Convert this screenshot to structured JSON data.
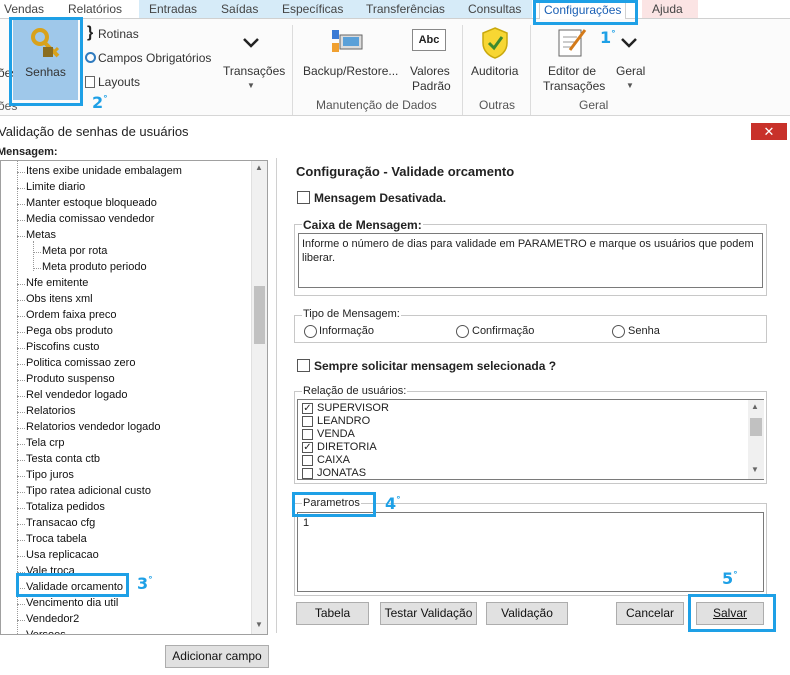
{
  "ribbon_tabs": [
    "Vendas",
    "Relatórios",
    "Entradas",
    "Saídas",
    "Específicas",
    "Transferências",
    "Consultas",
    "Configurações",
    "Ajuda"
  ],
  "ribbon": {
    "partial_left_1": "ões",
    "partial_left_2": "ões",
    "senhas": "Senhas",
    "rotinas": "Rotinas",
    "campos_obrigatorios": "Campos Obrigatórios",
    "layouts": "Layouts",
    "transacoes": "Transações",
    "backup": "Backup/Restore...",
    "valores": "Valores",
    "padrao": "Padrão",
    "manutencao_label": "Manutenção de Dados",
    "auditoria": "Auditoria",
    "outras_label": "Outras",
    "editor": "Editor de",
    "editor2": "Transações",
    "geral": "Geral",
    "geral_group": "Geral"
  },
  "steps": [
    "1",
    "2",
    "3",
    "4",
    "5"
  ],
  "step_mark": "°",
  "window": {
    "title": "Validação de senhas de usuários",
    "close": "✕"
  },
  "tree": {
    "header": "Mensagem:",
    "items": [
      "Itens exibe unidade embalagem",
      "Limite diario",
      "Manter estoque bloqueado",
      "Media comissao vendedor",
      "Metas",
      "Meta por rota",
      "Meta produto periodo",
      "Nfe emitente",
      "Obs itens xml",
      "Ordem faixa preco",
      "Pega obs produto",
      "Piscofins custo",
      "Politica comissao zero",
      "Produto suspenso",
      "Rel vendedor logado",
      "Relatorios",
      "Relatorios vendedor logado",
      "Tela crp",
      "Testa conta ctb",
      "Tipo juros",
      "Tipo ratea adicional custo",
      "Totaliza pedidos",
      "Transacao cfg",
      "Troca tabela",
      "Usa replicacao",
      "Vale troca",
      "Validade orcamento",
      "Vencimento dia util",
      "Vendedor2",
      "Versoes"
    ]
  },
  "panel": {
    "title": "Configuração - Validade orcamento",
    "desativada": "Mensagem Desativada.",
    "caixa_label": "Caixa de Mensagem:",
    "caixa_text": "Informe o número de dias para validade em PARAMETRO e marque os usuários que podem liberar.",
    "tipo_label": "Tipo de Mensagem:",
    "tipo_options": [
      "Informação",
      "Confirmação",
      "Senha"
    ],
    "sempre": "Sempre solicitar mensagem selecionada ?",
    "relacao_label": "Relação de usuários:",
    "users": [
      {
        "name": "SUPERVISOR",
        "checked": true
      },
      {
        "name": "LEANDRO",
        "checked": false
      },
      {
        "name": "VENDA",
        "checked": false
      },
      {
        "name": "DIRETORIA",
        "checked": true
      },
      {
        "name": "CAIXA",
        "checked": false
      },
      {
        "name": "JONATAS",
        "checked": false
      }
    ],
    "check_mark": "✓",
    "parametros_label": "Parametros",
    "parametros_value": "1"
  },
  "buttons": {
    "tabela": "Tabela",
    "testar": "Testar Validação",
    "validacao": "Validação",
    "cancelar": "Cancelar",
    "salvar": "Salvar",
    "adicionar": "Adicionar campo"
  },
  "colors": {
    "highlight": "#1ea0e6",
    "close": "#c8312a",
    "selected_tab": "#1a5fb4"
  }
}
